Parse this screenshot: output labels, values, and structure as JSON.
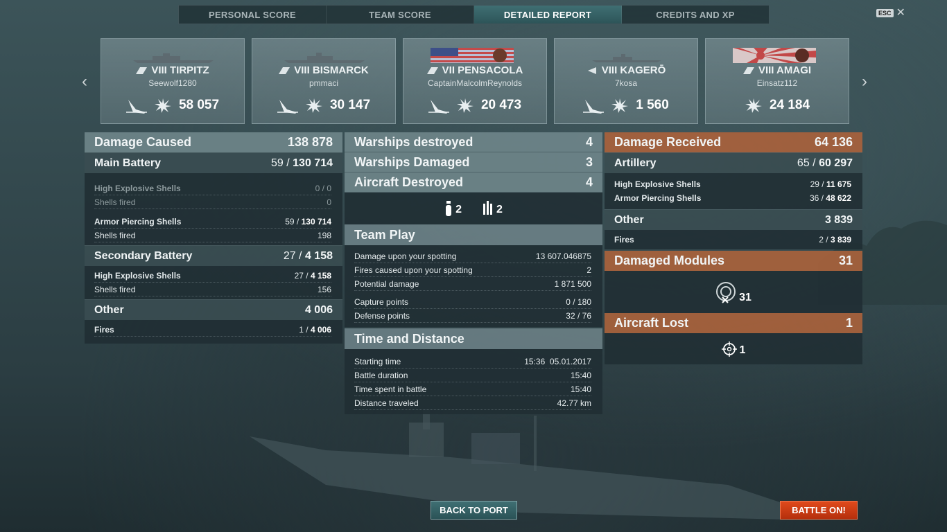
{
  "tabs": [
    {
      "label": "PERSONAL SCORE"
    },
    {
      "label": "TEAM SCORE"
    },
    {
      "label": "DETAILED REPORT"
    },
    {
      "label": "CREDITS AND XP"
    }
  ],
  "esc": {
    "key": "ESC",
    "close": "✕"
  },
  "nav": {
    "prev": "‹",
    "next": "›"
  },
  "ships": [
    {
      "tier_name": "VIII TIRPITZ",
      "player": "Seewolf1280",
      "score": "58 057"
    },
    {
      "tier_name": "VIII BISMARCK",
      "player": "pmmaci",
      "score": "30 147"
    },
    {
      "tier_name": "VII PENSACOLA",
      "player": "CaptainMalcolmReynolds",
      "score": "20 473"
    },
    {
      "tier_name": "VIII KAGERŌ",
      "player": "7kosa",
      "score": "1 560"
    },
    {
      "tier_name": "VIII AMAGI",
      "player": "Einsatz112",
      "score": "24 184"
    }
  ],
  "left": {
    "damage_caused": {
      "label": "Damage Caused",
      "value": "138 878"
    },
    "main_battery": {
      "label": "Main Battery",
      "hits": "59 /",
      "dmg": "130 714"
    },
    "mb_he": {
      "label": "High Explosive Shells",
      "value": "0 / 0"
    },
    "mb_he_fired": {
      "label": "Shells fired",
      "value": "0"
    },
    "mb_ap": {
      "label": "Armor Piercing Shells",
      "hits": "59 /",
      "dmg": "130 714"
    },
    "mb_ap_fired": {
      "label": "Shells fired",
      "value": "198"
    },
    "secondary": {
      "label": "Secondary Battery",
      "hits": "27 /",
      "dmg": "4 158"
    },
    "sec_he": {
      "label": "High Explosive Shells",
      "hits": "27 /",
      "dmg": "4 158"
    },
    "sec_fired": {
      "label": "Shells fired",
      "value": "156"
    },
    "other": {
      "label": "Other",
      "value": "4 006"
    },
    "fires": {
      "label": "Fires",
      "hits": "1 /",
      "dmg": "4 006"
    }
  },
  "middle": {
    "warships_destroyed": {
      "label": "Warships destroyed",
      "value": "4"
    },
    "warships_damaged": {
      "label": "Warships Damaged",
      "value": "3"
    },
    "aircraft_destroyed": {
      "label": "Aircraft Destroyed",
      "value": "4"
    },
    "aircraft_icons": [
      {
        "value": "2"
      },
      {
        "value": "2"
      }
    ],
    "team_play": {
      "title": "Team Play",
      "rows": [
        {
          "label": "Damage upon your spotting",
          "value": "13 607.046875"
        },
        {
          "label": "Fires caused upon your spotting",
          "value": "2"
        },
        {
          "label": "Potential damage",
          "value": "1 871 500"
        },
        {
          "label": "Capture points",
          "value": "0 / 180"
        },
        {
          "label": "Defense points",
          "value": "32 / 76"
        }
      ]
    },
    "time_distance": {
      "title": "Time and Distance",
      "rows": [
        {
          "label": "Starting time",
          "value": "15:36  05.01.2017"
        },
        {
          "label": "Battle duration",
          "value": "15:40"
        },
        {
          "label": "Time spent in battle",
          "value": "15:40"
        },
        {
          "label": "Distance traveled",
          "value": "42.77 km"
        }
      ]
    }
  },
  "right": {
    "damage_received": {
      "label": "Damage Received",
      "value": "64 136"
    },
    "artillery": {
      "label": "Artillery",
      "hits": "65 /",
      "dmg": "60 297"
    },
    "art_he": {
      "label": "High Explosive Shells",
      "hits": "29 /",
      "dmg": "11 675"
    },
    "art_ap": {
      "label": "Armor Piercing Shells",
      "hits": "36 /",
      "dmg": "48 622"
    },
    "other": {
      "label": "Other",
      "value": "3 839"
    },
    "fires": {
      "label": "Fires",
      "hits": "2 /",
      "dmg": "3 839"
    },
    "damaged_modules": {
      "label": "Damaged Modules",
      "value": "31",
      "icon_value": "31"
    },
    "aircraft_lost": {
      "label": "Aircraft Lost",
      "value": "1",
      "icon_value": "1"
    }
  },
  "buttons": {
    "back_to_port": "BACK TO PORT",
    "battle_on": "BATTLE ON!"
  },
  "colors": {
    "accent_tab": "#3f6f73",
    "orange_header": "#a8623c",
    "battle_button": "#d8431a"
  }
}
